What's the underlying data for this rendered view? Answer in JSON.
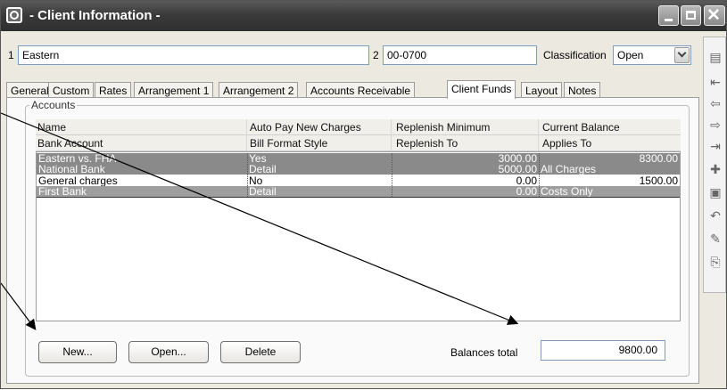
{
  "window": {
    "title": "- Client Information -",
    "controls": {
      "minimize": "minimize-icon",
      "maximize": "maximize-icon",
      "close": "close-icon"
    }
  },
  "header": {
    "client_num_label": "1",
    "client_name": "Eastern",
    "matter_num_label": "2",
    "matter_number": "00-0700",
    "classification_label": "Classification",
    "classification_value": "Open"
  },
  "tabs": [
    {
      "label": "General"
    },
    {
      "label": "Custom"
    },
    {
      "label": "Rates"
    },
    {
      "label": "Arrangement 1"
    },
    {
      "label": "Arrangement 2"
    },
    {
      "label": "Accounts Receivable"
    },
    {
      "label": "Client Funds",
      "active": true
    },
    {
      "label": "Layout"
    },
    {
      "label": "Notes"
    }
  ],
  "accounts": {
    "group_label": "Accounts",
    "columns_row1": [
      "Name",
      "Auto Pay New Charges",
      "Replenish Minimum",
      "Current Balance"
    ],
    "columns_row2": [
      "Bank Account",
      "Bill Format Style",
      "Replenish To",
      "Applies To"
    ],
    "rows": [
      {
        "name": "Eastern vs. FHA",
        "auto_pay": "Yes",
        "replenish_min": "3000.00",
        "current_balance": "8300.00",
        "bank": "National Bank",
        "bill_format": "Detail",
        "replenish_to": "5000.00",
        "applies_to": "All Charges",
        "selected": true
      },
      {
        "name": "General charges",
        "auto_pay": "No",
        "replenish_min": "0.00",
        "current_balance": "1500.00",
        "bank": "First Bank",
        "bill_format": "Detail",
        "replenish_to": "0.00",
        "applies_to": "Costs Only",
        "selected": false
      }
    ]
  },
  "buttons": {
    "new": "New...",
    "open": "Open...",
    "delete": "Delete"
  },
  "balances": {
    "label": "Balances total",
    "value": "9800.00"
  },
  "toolbar_icons": [
    "report-icon",
    "first-record-icon",
    "previous-record-icon",
    "next-record-icon",
    "last-record-icon",
    "add-icon",
    "save-icon",
    "undo-icon",
    "edit-document-icon",
    "export-document-icon"
  ],
  "colors": {
    "titlebar": "#3a3a3a",
    "selected_row": "#8a8a8a",
    "field_border": "#7f9db9"
  }
}
